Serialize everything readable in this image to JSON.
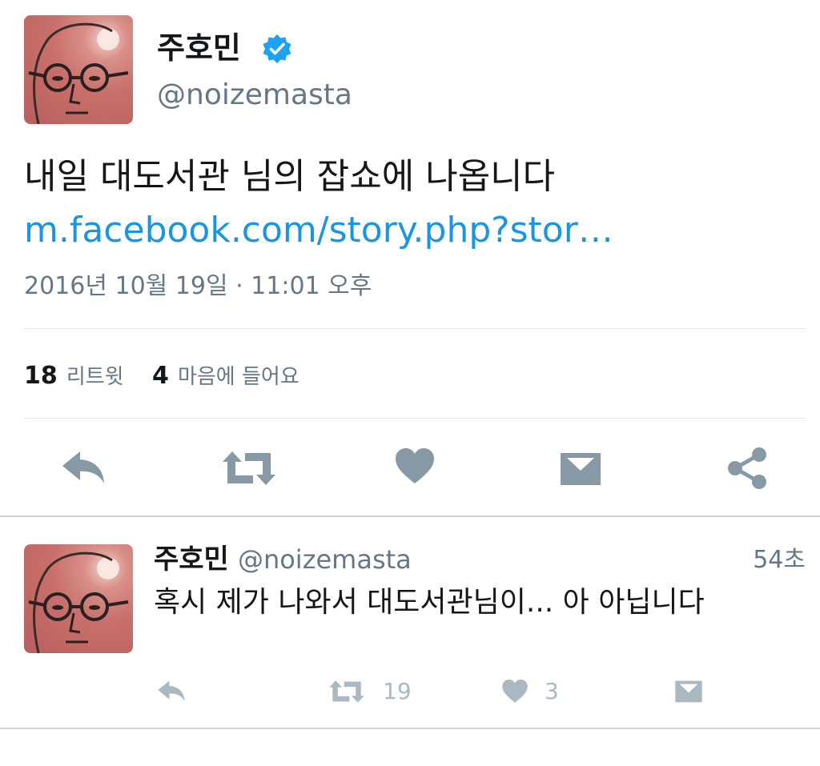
{
  "tweet": {
    "author_name": "주호민",
    "author_handle": "@noizemasta",
    "verified_icon": "verified-badge-icon",
    "text": "내일 대도서관 님의 잡쇼에 나옵니다",
    "link": "m.facebook.com/story.php?stor…",
    "timestamp": "2016년 10월 19일 · 11:01 오후",
    "retweet_count": "18",
    "retweet_label": "리트윗",
    "like_count": "4",
    "like_label": "마음에 들어요",
    "actions": [
      "reply-icon",
      "retweet-icon",
      "heart-icon",
      "direct-message-icon",
      "share-icon"
    ]
  },
  "reply": {
    "author_name": "주호민",
    "author_handle": "@noizemasta",
    "time": "54초",
    "text": "혹시 제가 나와서 대도서관님이... 아 아닙니다",
    "retweet_count": "19",
    "like_count": "3"
  },
  "colors": {
    "link": "#1b95e0",
    "icon": "#8899a6",
    "icon_light": "#aab8c2",
    "verified": "#1da1f2",
    "divider": "#e1e8ed"
  }
}
